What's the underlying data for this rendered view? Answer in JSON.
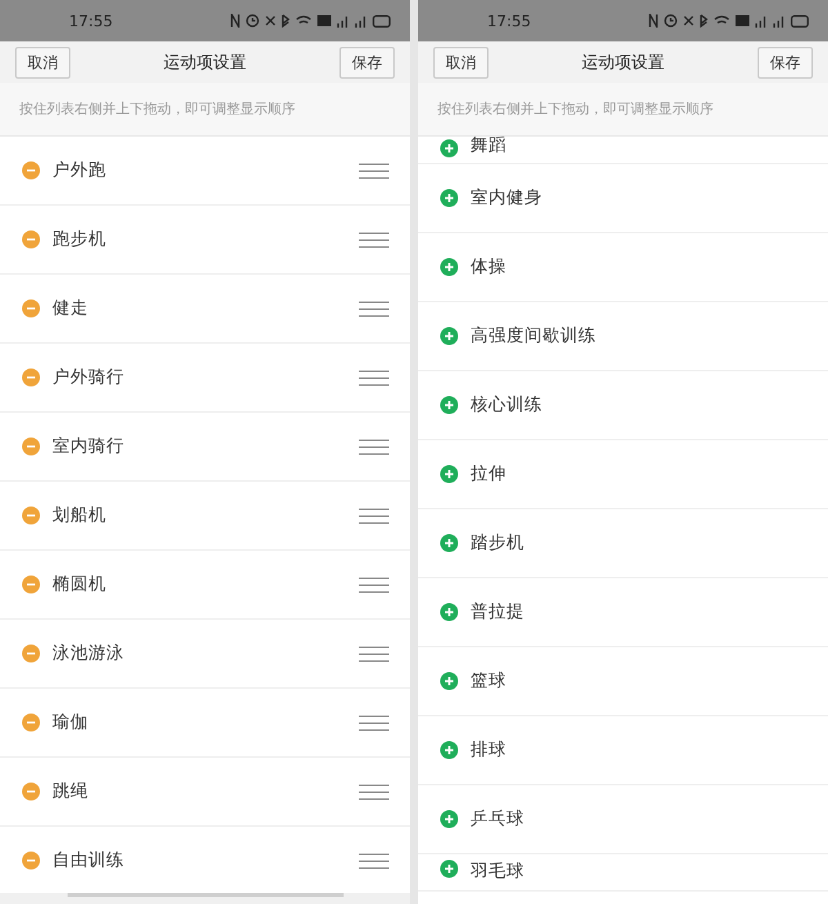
{
  "screens": [
    {
      "status_bar": {
        "time": "17:55"
      },
      "header": {
        "cancel": "取消",
        "title": "运动项设置",
        "save": "保存"
      },
      "hint": "按住列表右侧并上下拖动，即可调整显示顺序",
      "items": [
        {
          "label": "户外跑",
          "kind": "remove"
        },
        {
          "label": "跑步机",
          "kind": "remove"
        },
        {
          "label": "健走",
          "kind": "remove"
        },
        {
          "label": "户外骑行",
          "kind": "remove"
        },
        {
          "label": "室内骑行",
          "kind": "remove"
        },
        {
          "label": "划船机",
          "kind": "remove"
        },
        {
          "label": "椭圆机",
          "kind": "remove"
        },
        {
          "label": "泳池游泳",
          "kind": "remove"
        },
        {
          "label": "瑜伽",
          "kind": "remove"
        },
        {
          "label": "跳绳",
          "kind": "remove"
        },
        {
          "label": "自由训练",
          "kind": "remove"
        }
      ]
    },
    {
      "status_bar": {
        "time": "17:55"
      },
      "header": {
        "cancel": "取消",
        "title": "运动项设置",
        "save": "保存"
      },
      "hint": "按住列表右侧并上下拖动，即可调整显示顺序",
      "items": [
        {
          "label": "舞蹈",
          "kind": "add"
        },
        {
          "label": "室内健身",
          "kind": "add"
        },
        {
          "label": "体操",
          "kind": "add"
        },
        {
          "label": "高强度间歇训练",
          "kind": "add"
        },
        {
          "label": "核心训练",
          "kind": "add"
        },
        {
          "label": "拉伸",
          "kind": "add"
        },
        {
          "label": "踏步机",
          "kind": "add"
        },
        {
          "label": "普拉提",
          "kind": "add"
        },
        {
          "label": "篮球",
          "kind": "add"
        },
        {
          "label": "排球",
          "kind": "add"
        },
        {
          "label": "乒乓球",
          "kind": "add"
        },
        {
          "label": "羽毛球",
          "kind": "add"
        }
      ]
    }
  ]
}
